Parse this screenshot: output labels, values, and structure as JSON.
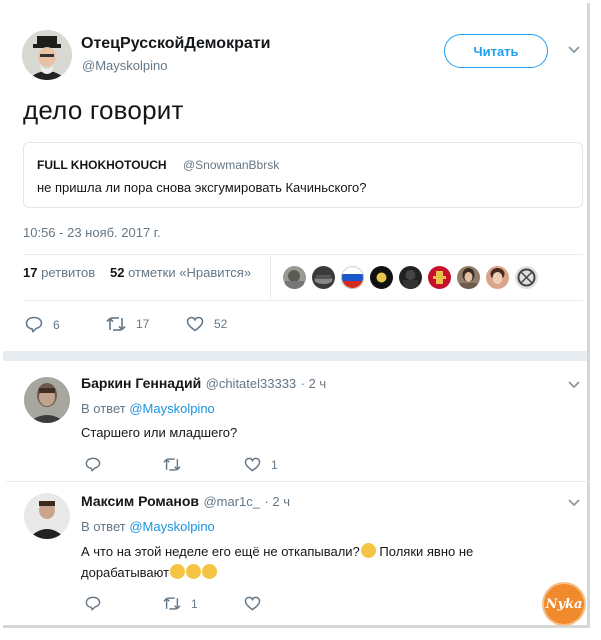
{
  "tweet": {
    "author_name": "ОтецРусскойДемократи",
    "author_handle": "@Mayskolpino",
    "follow_label": "Читать",
    "text": "дело говорит",
    "quote": {
      "name": "FULL KHOKHOTOUCH",
      "handle": "@SnowmanBbrsk",
      "text": "не пришла ли пора снова эксгумировать Качиньского?"
    },
    "timestamp": "10:56 - 23 нояб. 2017 г.",
    "stats": {
      "retweets_count": "17",
      "retweets_label": "ретвитов",
      "likes_count": "52",
      "likes_label": "отметки «Нравится»"
    },
    "actions": {
      "reply_count": "6",
      "retweet_count": "17",
      "like_count": "52"
    }
  },
  "replies": [
    {
      "name": "Баркин Геннадий",
      "handle": "@chitatel33333",
      "time": "· 2 ч",
      "reply_to_prefix": "В ответ",
      "reply_to_handle": "@Mayskolpino",
      "text": "Старшего или младшего?",
      "like_count": "1",
      "retweet_count": ""
    },
    {
      "name": "Максим Романов",
      "handle": "@mar1c_",
      "time": "· 2 ч",
      "reply_to_prefix": "В ответ",
      "reply_to_handle": "@Mayskolpino",
      "text_line1": "А что на этой неделе его ещё не откапывали?",
      "text_line1b": "Поляки явно не",
      "text_line2": "дорабатывают",
      "retweet_count": "1",
      "like_count": ""
    }
  ],
  "watermark": "Nyka",
  "colors": {
    "accent": "#1da1f2",
    "link": "#1b95e0",
    "muted": "#657786",
    "divider": "#e6ecf0"
  }
}
